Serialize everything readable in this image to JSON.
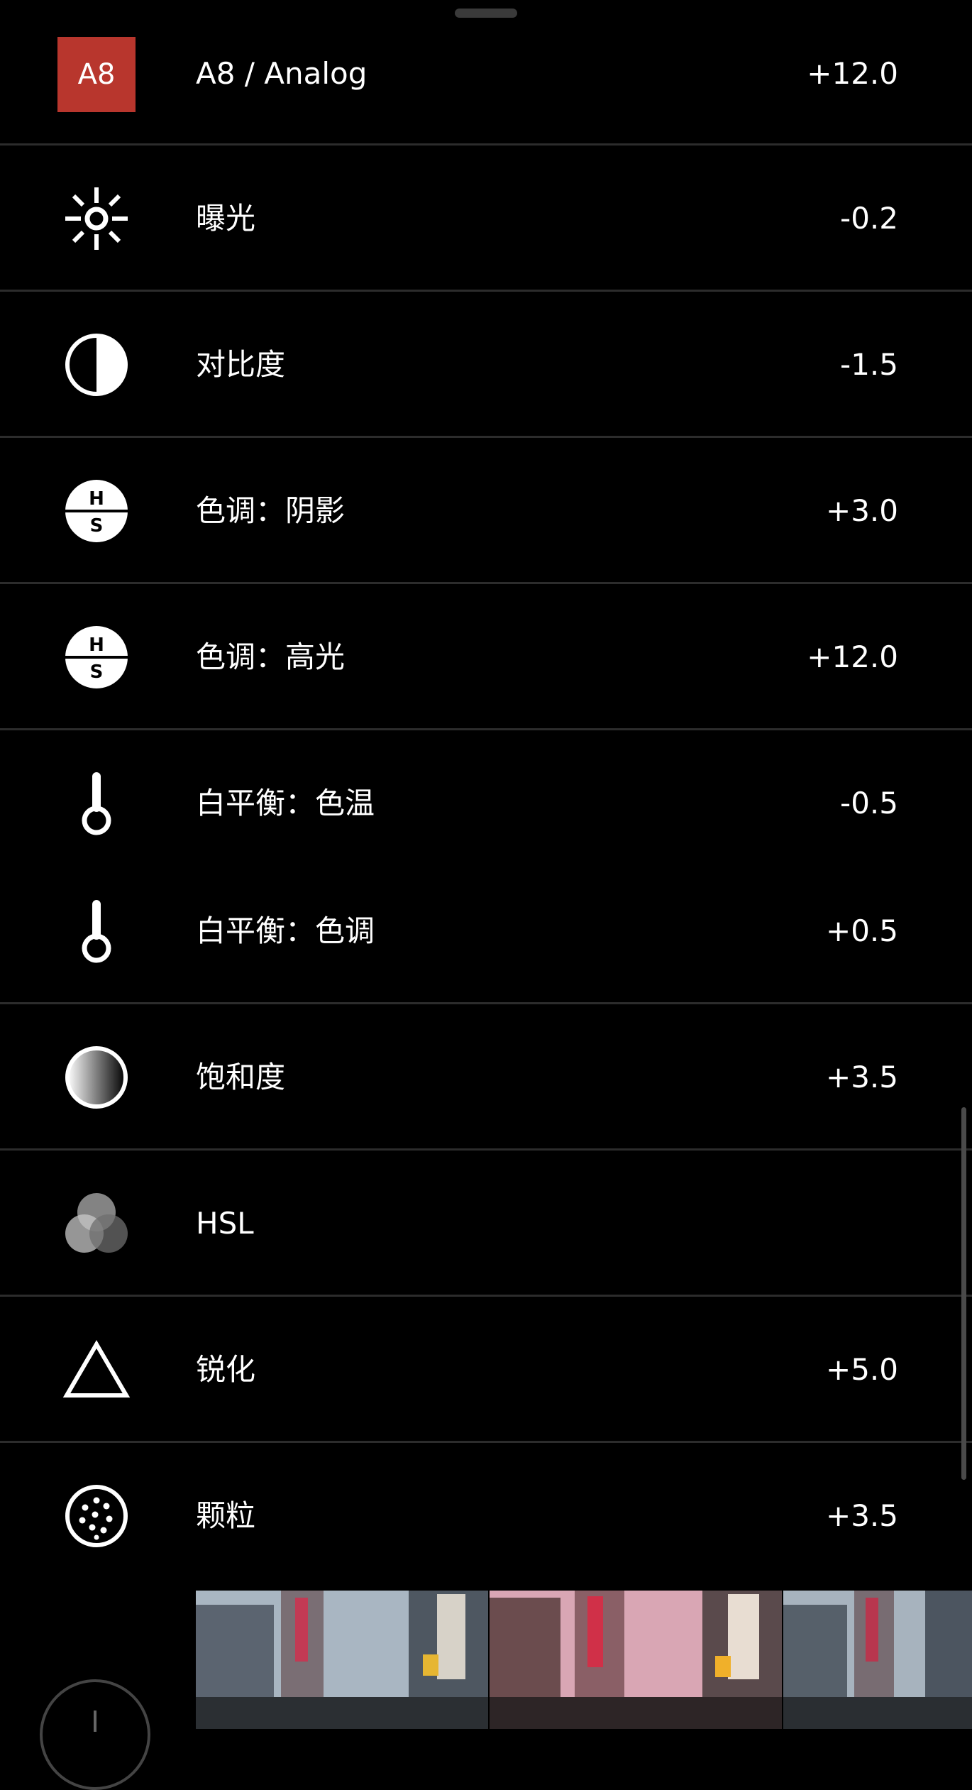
{
  "preset": {
    "badge": "A8",
    "name": "A8 / Analog",
    "value": "+12.0",
    "color": "#b8362d"
  },
  "adjustments": [
    {
      "key": "exposure",
      "icon": "sun-icon",
      "label": "曝光",
      "value": "-0.2"
    },
    {
      "key": "contrast",
      "icon": "contrast-icon",
      "label": "对比度",
      "value": "-1.5"
    },
    {
      "key": "tone-shadows",
      "icon": "hs-icon",
      "label": "色调：阴影",
      "value": "+3.0"
    },
    {
      "key": "tone-highlights",
      "icon": "hs-icon",
      "label": "色调：高光",
      "value": "+12.0"
    },
    {
      "key": "wb-temperature",
      "icon": "thermometer-icon",
      "label": "白平衡：色温",
      "value": "-0.5"
    },
    {
      "key": "wb-tint",
      "icon": "thermometer-icon",
      "label": "白平衡：色调",
      "value": "+0.5"
    },
    {
      "key": "saturation",
      "icon": "gradient-circle-icon",
      "label": "饱和度",
      "value": "+3.5"
    },
    {
      "key": "hsl",
      "icon": "overlapping-circles-icon",
      "label": "HSL",
      "value": ""
    },
    {
      "key": "sharpen",
      "icon": "triangle-icon",
      "label": "锐化",
      "value": "+5.0"
    },
    {
      "key": "grain",
      "icon": "grain-icon",
      "label": "颗粒",
      "value": "+3.5"
    }
  ],
  "thumbnails": [
    {
      "name": "thumbnail-1",
      "tint": "#8a9aa8"
    },
    {
      "name": "thumbnail-2",
      "tint": "#b07a8a"
    },
    {
      "name": "thumbnail-3",
      "tint": "#7f8e9c"
    }
  ]
}
